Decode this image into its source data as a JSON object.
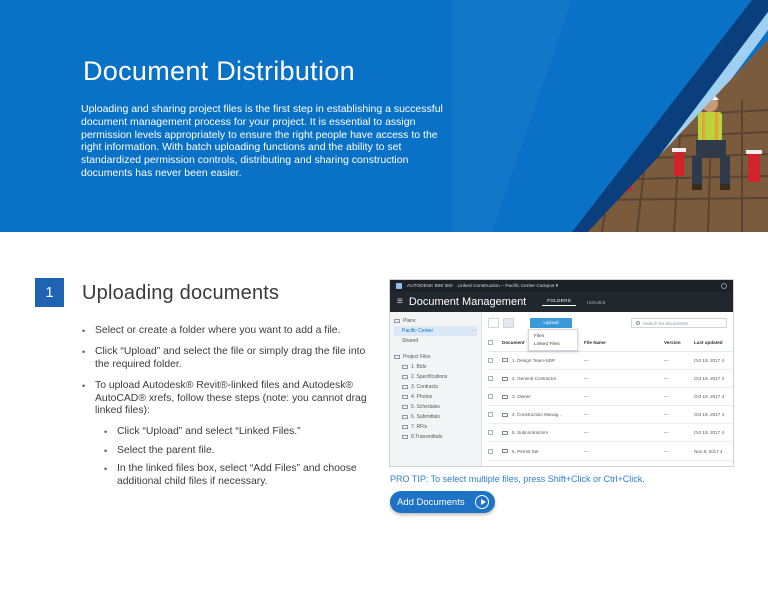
{
  "hero": {
    "title": "Document Distribution",
    "body": "Uploading and sharing project files is the first step in establishing a successful document management process for your project. It is essential to assign permission levels appropriately to ensure the right people have access to the right information. With batch uploading functions and the ability to set standardized permission controls, distributing and sharing construction documents has never been easier.",
    "accent_color": "#0a72c6"
  },
  "section": {
    "number": "1",
    "title": "Uploading documents",
    "steps": [
      "Select or create a folder where you want to add a file.",
      "Click “Upload” and select the file or simply drag the file into the required folder.",
      "To upload Autodesk® Revit®-linked files and Autodesk® AutoCAD® xrefs, follow these steps (note: you cannot drag linked files):"
    ],
    "substeps": [
      "Click “Upload” and select “Linked Files.”",
      "Select the parent file.",
      "In the linked files box, select “Add Files” and choose additional child files if necessary."
    ]
  },
  "screenshot": {
    "topbar": {
      "brand": "AUTODESK BIM 360",
      "project": "Linked Construction – Pacific Center Campus ▾"
    },
    "header": {
      "title": "Document Management",
      "tabs": [
        "FOLDERS",
        "ISSUES"
      ]
    },
    "sidebar": {
      "plans_label": "Plans",
      "plans_items": [
        "Pacific Center",
        "Shared"
      ],
      "project_files_label": "Project Files",
      "folders": [
        "1. Bids",
        "2. Specifications",
        "3. Contracts",
        "4. Photos",
        "5. Schedules",
        "6. Submittals",
        "7. RFIs",
        "8.Transmittals"
      ]
    },
    "toolbar": {
      "upload_label": "Upload",
      "search_placeholder": "Search for documents"
    },
    "dropdown": [
      "Files",
      "Linked Files"
    ],
    "table": {
      "headers": [
        "Document",
        "File Name",
        "Version",
        "Last updated"
      ],
      "rows": [
        {
          "name": "1. Design Team-NDP",
          "file": "—",
          "version": "—",
          "updated": "Oct 19, 2017 4"
        },
        {
          "name": "2. General Contractor",
          "file": "—",
          "version": "—",
          "updated": "Oct 19, 2017 4"
        },
        {
          "name": "3. Owner",
          "file": "—",
          "version": "—",
          "updated": "Oct 19, 2017 4"
        },
        {
          "name": "4. Construction Manag...",
          "file": "—",
          "version": "—",
          "updated": "Oct 19, 2017 4"
        },
        {
          "name": "5. Subcontractors",
          "file": "—",
          "version": "—",
          "updated": "Oct 19, 2017 4"
        },
        {
          "name": "6. Permit Set",
          "file": "—",
          "version": "—",
          "updated": "Nov 8, 2017 4"
        }
      ]
    }
  },
  "tip": "PRO TIP: To select multiple files, press Shift+Click or Ctrl+Click.",
  "cta": {
    "label": "Add Documents",
    "icon": "play-circle-icon"
  }
}
